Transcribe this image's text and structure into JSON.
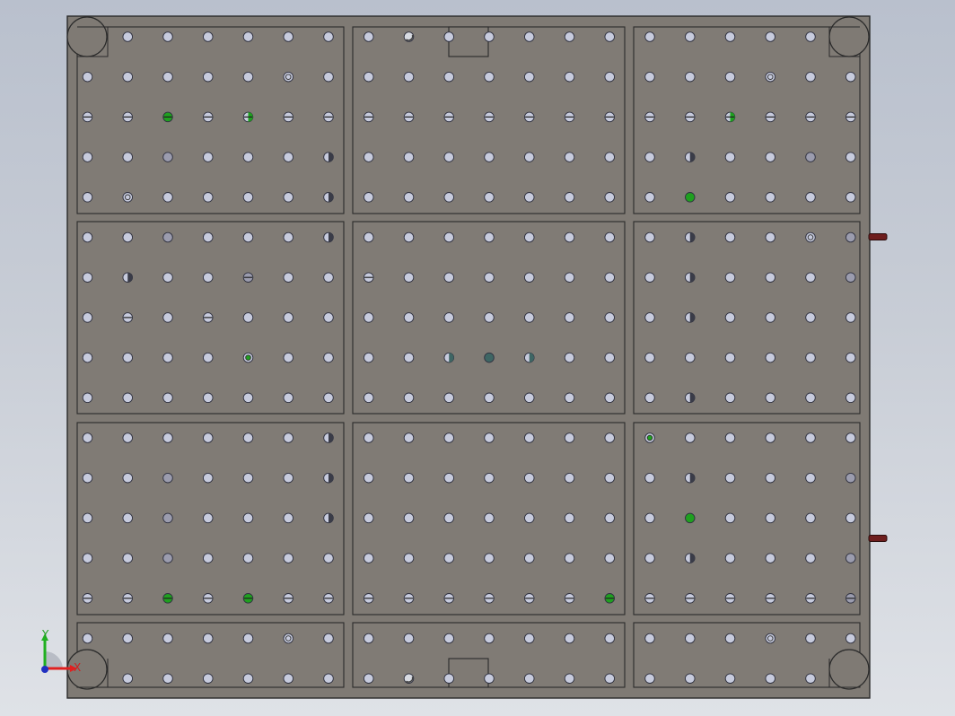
{
  "viewport": {
    "background": "#c8cdd6",
    "plate_color": "#7f7a74",
    "panel_color": "#807b75",
    "edge_color": "#2a2a2a"
  },
  "plate": {
    "panels": {
      "cols": 3,
      "rows": 4
    },
    "hole_grid": {
      "cols": 20,
      "rows": 17
    },
    "bolts_on_right_edge": 2,
    "notches": [
      "top-center",
      "bottom-center"
    ],
    "corner_bosses": 4
  },
  "hole_colors": {
    "normal": "#c7cbdd",
    "dark": "#9b9cae",
    "green": "#1fa01f",
    "teal": "#3e6664",
    "bolt": "#6e1e1e"
  },
  "triad": {
    "x_label": "X",
    "y_label": "Y",
    "x_color": "#e02020",
    "y_color": "#20b020",
    "z_color": "#2030c0"
  }
}
